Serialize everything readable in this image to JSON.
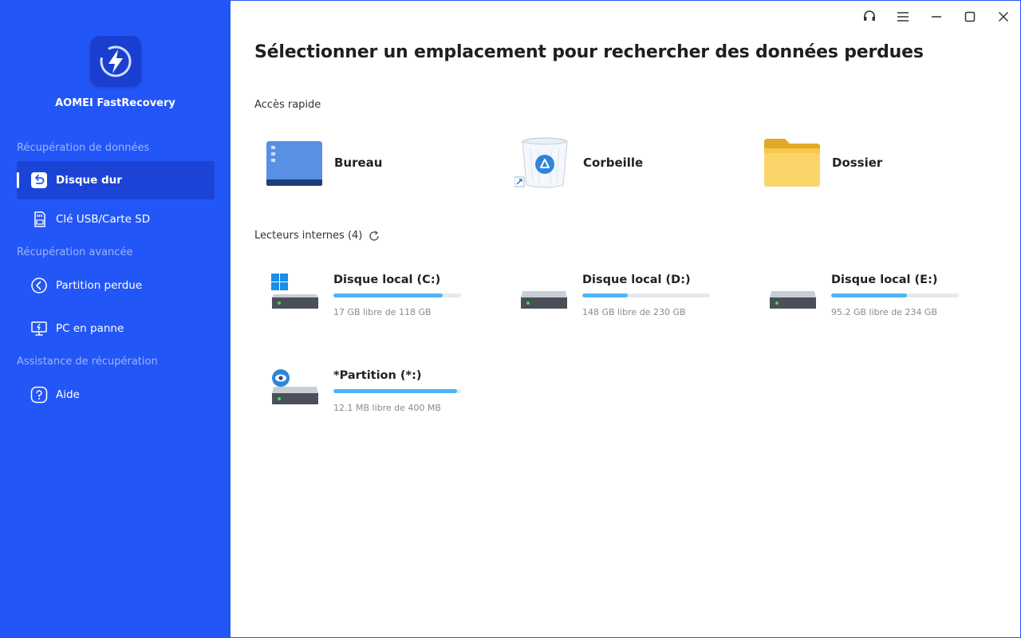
{
  "app": {
    "name": "AOMEI FastRecovery",
    "brand_color": "#2356f6",
    "accent_color": "#4fb3f6"
  },
  "sidebar": {
    "sections": [
      {
        "title": "Récupération de données"
      },
      {
        "title": "Récupération avancée"
      },
      {
        "title": "Assistance de récupération"
      }
    ],
    "items": [
      {
        "label": "Disque dur",
        "icon": "hard-disk-restore-icon",
        "active": true
      },
      {
        "label": "Clé USB/Carte SD",
        "icon": "sd-card-icon",
        "active": false
      },
      {
        "label": "Partition perdue",
        "icon": "lost-partition-icon",
        "active": false
      },
      {
        "label": "PC en panne",
        "icon": "crashed-pc-icon",
        "active": false
      },
      {
        "label": "Aide",
        "icon": "help-icon",
        "active": false
      }
    ]
  },
  "window_controls": [
    "headset-icon",
    "menu-icon",
    "minimize-icon",
    "maximize-icon",
    "close-icon"
  ],
  "main": {
    "title": "Sélectionner un emplacement pour rechercher des données perdues",
    "quick_access": {
      "label": "Accès rapide",
      "items": [
        {
          "label": "Bureau",
          "icon": "desktop-icon"
        },
        {
          "label": "Corbeille",
          "icon": "recycle-bin-icon"
        },
        {
          "label": "Dossier",
          "icon": "folder-icon"
        }
      ]
    },
    "drives": {
      "label": "Lecteurs internes (4)",
      "items": [
        {
          "name": "Disque local (C:)",
          "free": "17 GB libre de 118 GB",
          "used_fraction": 0.856,
          "icon": "system-drive-icon"
        },
        {
          "name": "Disque local (D:)",
          "free": "148 GB libre de 230 GB",
          "used_fraction": 0.357,
          "icon": "drive-icon"
        },
        {
          "name": "Disque local (E:)",
          "free": "95.2 GB libre de 234 GB",
          "used_fraction": 0.593,
          "icon": "drive-icon"
        },
        {
          "name": "*Partition (*:)",
          "free": "12.1 MB libre de 400 MB",
          "used_fraction": 0.97,
          "icon": "hidden-partition-drive-icon"
        }
      ]
    }
  }
}
